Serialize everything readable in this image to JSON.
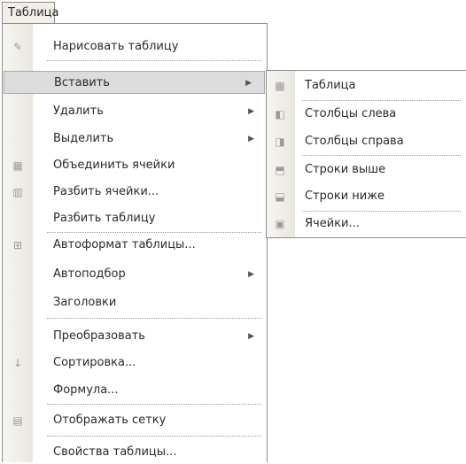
{
  "menubar": {
    "title": "Таблица"
  },
  "menu": {
    "items": [
      {
        "label": "Нарисовать таблицу",
        "icon": "pencil-table-icon"
      },
      {
        "label": "Вставить",
        "has_submenu": true,
        "highlighted": true
      },
      {
        "label": "Удалить",
        "has_submenu": true
      },
      {
        "label": "Выделить",
        "has_submenu": true
      },
      {
        "label": "Объединить ячейки",
        "icon": "merge-cells-icon"
      },
      {
        "label": "Разбить ячейки...",
        "icon": "split-cells-icon"
      },
      {
        "label": "Разбить таблицу"
      },
      {
        "label": "Автоформат таблицы...",
        "icon": "autoformat-icon"
      },
      {
        "label": "Автоподбор",
        "has_submenu": true
      },
      {
        "label": "Заголовки"
      },
      {
        "label": "Преобразовать",
        "has_submenu": true
      },
      {
        "label": "Сортировка...",
        "icon": "sort-az-icon"
      },
      {
        "label": "Формула..."
      },
      {
        "label": "Отображать сетку",
        "icon": "grid-icon"
      },
      {
        "label": "Свойства таблицы..."
      }
    ]
  },
  "submenu": {
    "items": [
      {
        "label": "Таблица",
        "icon": "insert-table-icon"
      },
      {
        "label": "Столбцы слева",
        "icon": "columns-left-icon"
      },
      {
        "label": "Столбцы справа",
        "icon": "columns-right-icon"
      },
      {
        "label": "Строки выше",
        "icon": "rows-above-icon"
      },
      {
        "label": "Строки ниже",
        "icon": "rows-below-icon"
      },
      {
        "label": "Ячейки...",
        "icon": "insert-cells-icon"
      }
    ]
  },
  "glyphs": {
    "submenu_arrow": "▶"
  }
}
